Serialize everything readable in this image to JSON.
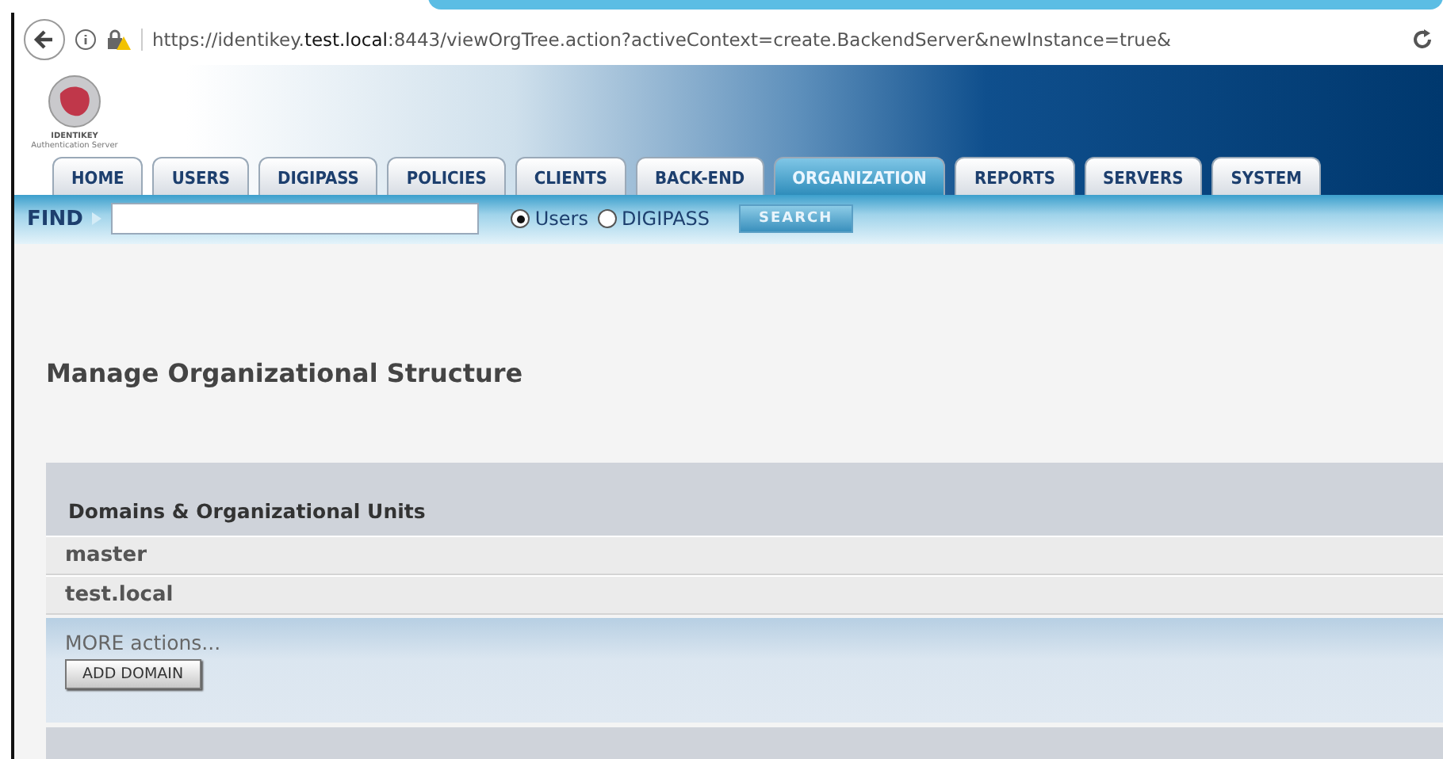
{
  "browser": {
    "url": "https://identikey.**test.local**:8443/viewOrgTree.action?activeContext=create.BackendServer&newInstance=true&"
  },
  "logo": {
    "name": "IDENTIKEY",
    "subtitle": "Authentication Server"
  },
  "tabs": [
    {
      "label": "HOME",
      "selected": false
    },
    {
      "label": "USERS",
      "selected": false
    },
    {
      "label": "DIGIPASS",
      "selected": false
    },
    {
      "label": "POLICIES",
      "selected": false
    },
    {
      "label": "CLIENTS",
      "selected": false
    },
    {
      "label": "BACK-END",
      "selected": false
    },
    {
      "label": "ORGANIZATION",
      "selected": true
    },
    {
      "label": "REPORTS",
      "selected": false
    },
    {
      "label": "SERVERS",
      "selected": false
    },
    {
      "label": "SYSTEM",
      "selected": false
    }
  ],
  "find": {
    "label": "FIND",
    "options": [
      {
        "label": "Users",
        "selected": true
      },
      {
        "label": "DIGIPASS",
        "selected": false
      }
    ],
    "button": "SEARCH"
  },
  "page_title": "Manage Organizational Structure",
  "panel": {
    "title": "Domains & Organizational Units",
    "rows": [
      "master",
      "test.local"
    ],
    "more_label": "MORE actions...",
    "button": "ADD DOMAIN"
  }
}
